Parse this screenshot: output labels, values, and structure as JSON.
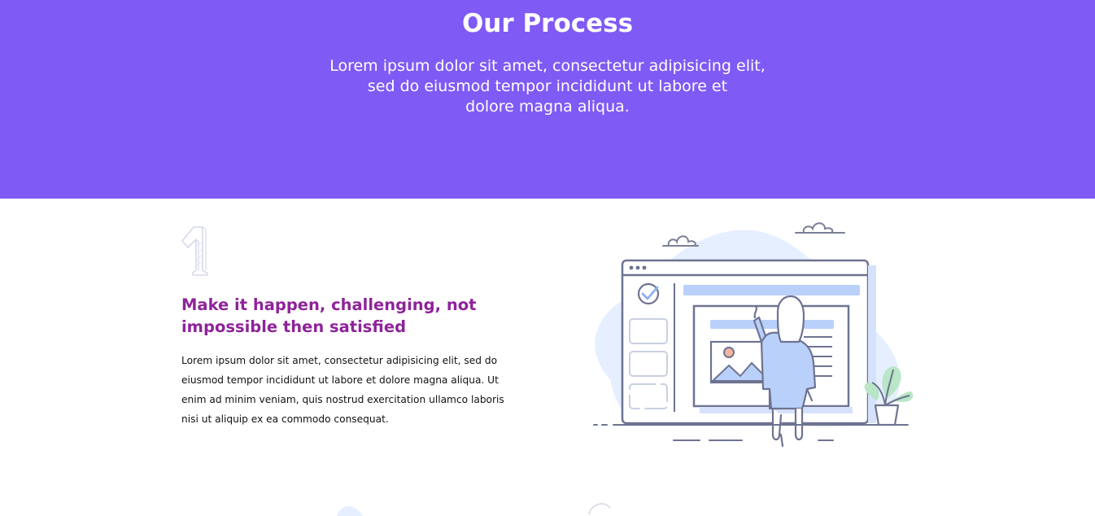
{
  "hero": {
    "title": "Our Process",
    "subtitle_lines": [
      "Lorem ipsum dolor sit amet, consectetur adipisicing elit,",
      "sed do eiusmod tempor incididunt ut labore et",
      "dolore magna aliqua."
    ],
    "background_color": "#7f5af5"
  },
  "step": {
    "number": "1",
    "heading_lines": [
      "Make it happen, challenging, not",
      "impossible then satisfied"
    ],
    "heading_color": "#8e239a",
    "body_lines": [
      "Lorem ipsum dolor sit amet, consectetur adipisicing elit, sed do",
      "eiusmod tempor incididunt ut labore et dolore magna aliqua. Ut",
      "enim ad minim veniam, quis nostrud exercitation ullamco laboris",
      "nisi ut aliquip ex ea commodo consequat."
    ],
    "illustration_icon": "person-drawing-on-browser-window-illustration"
  }
}
